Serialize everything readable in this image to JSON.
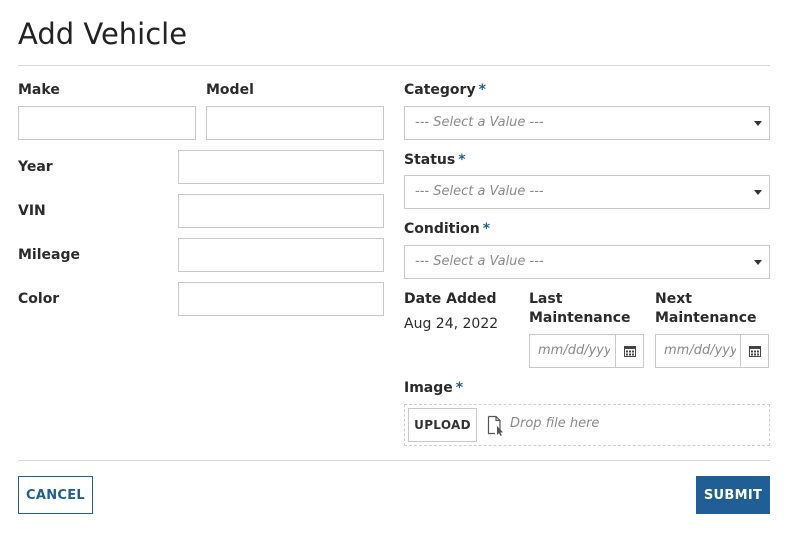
{
  "title": "Add Vehicle",
  "colors": {
    "accent": "#1f5f96",
    "required": "#1f5f96",
    "border": "#c9c9c9"
  },
  "fields": {
    "make": {
      "label": "Make",
      "value": ""
    },
    "model": {
      "label": "Model",
      "value": ""
    },
    "year": {
      "label": "Year",
      "value": ""
    },
    "vin": {
      "label": "VIN",
      "value": ""
    },
    "mileage": {
      "label": "Mileage",
      "value": ""
    },
    "color": {
      "label": "Color",
      "value": ""
    }
  },
  "selects": {
    "category": {
      "label": "Category",
      "required": "*",
      "placeholder": "--- Select a Value ---"
    },
    "status": {
      "label": "Status",
      "required": "*",
      "placeholder": "--- Select a Value ---"
    },
    "condition": {
      "label": "Condition",
      "required": "*",
      "placeholder": "--- Select a Value ---"
    }
  },
  "dates": {
    "date_added": {
      "label": "Date Added",
      "value": "Aug 24, 2022"
    },
    "last_maintenance": {
      "label_line1": "Last",
      "label_line2": "Maintenance",
      "placeholder": "mm/dd/yyyy",
      "icon": "calendar-icon"
    },
    "next_maintenance": {
      "label_line1": "Next",
      "label_line2": "Maintenance",
      "placeholder": "mm/dd/yyyy",
      "icon": "calendar-icon"
    }
  },
  "image": {
    "label": "Image",
    "required": "*",
    "upload_label": "UPLOAD",
    "drop_text": "Drop file here",
    "icon": "file-drop-icon"
  },
  "actions": {
    "cancel_label": "CANCEL",
    "submit_label": "SUBMIT"
  }
}
